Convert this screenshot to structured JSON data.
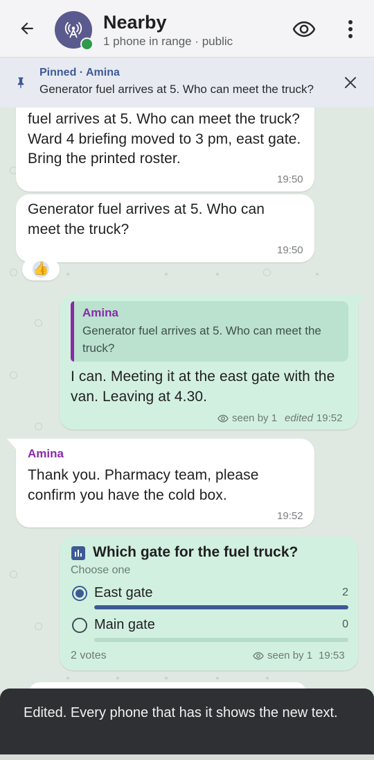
{
  "header": {
    "title": "Nearby",
    "subtitle": "1 phone in range · public",
    "back_icon": "arrow-left-icon",
    "avatar_icon": "broadcast-antenna-icon",
    "eye_icon": "eye-icon",
    "more_icon": "more-vertical-icon"
  },
  "pinned": {
    "label": "Pinned · Amina",
    "text": "Generator fuel arrives at 5. Who can meet the truck?",
    "icon": "pin-icon",
    "close_icon": "close-icon"
  },
  "messages": [
    {
      "text": "fuel arrives at 5. Who can meet the truck?Ward 4 briefing moved to 3 pm, east gate. Bring the printed roster.",
      "time": "19:50"
    },
    {
      "text": "Generator fuel arrives at 5. Who can meet the truck?",
      "time": "19:50",
      "reaction": "👍"
    },
    {
      "quote_name": "Amina",
      "quote_text": "Generator fuel arrives at 5. Who can meet the truck?",
      "text": "I can. Meeting it at the east gate with the van. Leaving at 4.30.",
      "seen": "seen by 1",
      "edited": "edited",
      "time": "19:52"
    },
    {
      "sender": "Amina",
      "text": "Thank you. Pharmacy team, please confirm you have the cold box.",
      "time": "19:52"
    }
  ],
  "poll": {
    "icon": "poll-icon",
    "question": "Which gate for the fuel truck?",
    "hint": "Choose one",
    "options": [
      {
        "label": "East gate",
        "count": "2",
        "fraction": 1.0,
        "selected": true
      },
      {
        "label": "Main gate",
        "count": "0",
        "fraction": 0.0,
        "selected": false
      }
    ],
    "votes": "2 votes",
    "seen": "seen by 1",
    "time": "19:53"
  },
  "snackbar": {
    "text": "Edited. Every phone that has it shows the new text."
  },
  "colors": {
    "accent": "#3d5a95",
    "sender": "#8a2aa8",
    "outgoing_bubble": "#d2f0e0",
    "incoming_bubble": "#ffffff",
    "chat_background": "#dfe9e1"
  }
}
